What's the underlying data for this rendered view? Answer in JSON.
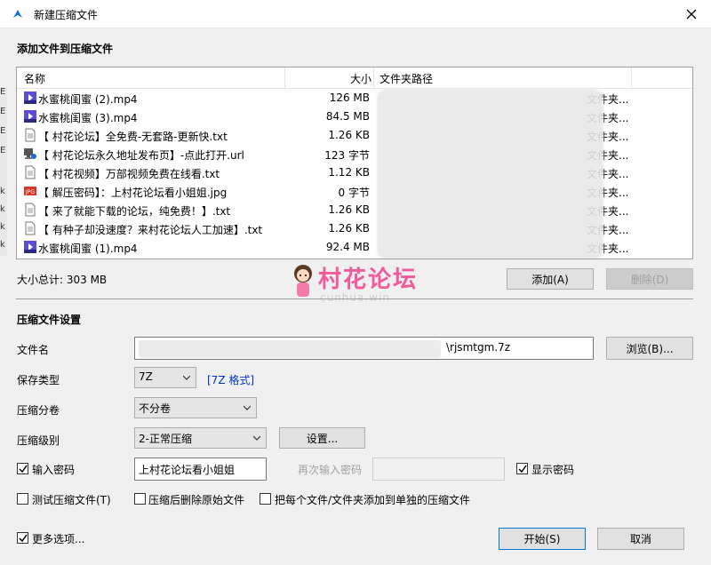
{
  "window": {
    "title": "新建压缩文件"
  },
  "background_strip": [
    "E",
    "E",
    "E",
    "E",
    "k",
    "k",
    "k",
    "k"
  ],
  "files_section": {
    "heading": "添加文件到压缩文件"
  },
  "table": {
    "columns": {
      "name": "名称",
      "size": "大小",
      "path": "文件夹路径"
    },
    "rows": [
      {
        "icon": "video-file-icon",
        "name": "水蜜桃闺蜜 (2).mp4",
        "size": "126 MB",
        "path": "文件夹..."
      },
      {
        "icon": "video-file-icon",
        "name": "水蜜桃闺蜜 (3).mp4",
        "size": "84.5 MB",
        "path": "文件夹..."
      },
      {
        "icon": "text-file-icon",
        "name": "【 村花论坛】全免费-无套路-更新快.txt",
        "size": "1.26 KB",
        "path": "文件夹..."
      },
      {
        "icon": "url-file-icon",
        "name": "【 村花论坛永久地址发布页】-点此打开.url",
        "size": "123 字节",
        "path": "文件夹..."
      },
      {
        "icon": "text-file-icon",
        "name": "【 村花视频】万部视频免费在线看.txt",
        "size": "1.12 KB",
        "path": "文件夹..."
      },
      {
        "icon": "jpg-file-icon",
        "name": "【 解压密码】：上村花论坛看小姐姐.jpg",
        "size": "0 字节",
        "path": "文件夹..."
      },
      {
        "icon": "text-file-icon",
        "name": "【 来了就能下载的论坛，纯免费！】.txt",
        "size": "1.26 KB",
        "path": "文件夹..."
      },
      {
        "icon": "text-file-icon",
        "name": "【 有种子却没速度？来村花论坛人工加速】.txt",
        "size": "1.26 KB",
        "path": "文件夹..."
      },
      {
        "icon": "video-file-icon",
        "name": "水蜜桃闺蜜 (1).mp4",
        "size": "92.4 MB",
        "path": "文件夹..."
      }
    ]
  },
  "total": {
    "label": "大小总计: 303 MB"
  },
  "watermark": {
    "title": "村花论坛",
    "subtitle": "cunhua.win"
  },
  "buttons": {
    "add": "添加(A)",
    "delete": "删除(D)",
    "browse": "浏览(B)...",
    "settings": "设置...",
    "start": "开始(S)",
    "cancel": "取消"
  },
  "settings_section": {
    "heading": "压缩文件设置"
  },
  "fields": {
    "filename_label": "文件名",
    "filename_value": "\\rjsmtgm.7z",
    "type_label": "保存类型",
    "type_value": "7Z",
    "type_link": "[7Z 格式]",
    "volume_label": "压缩分卷",
    "volume_value": "不分卷",
    "level_label": "压缩级别",
    "level_value": "2-正常压缩",
    "password_label": "输入密码",
    "password_value": "上村花论坛看小姐姐",
    "password_confirm_label": "再次输入密码",
    "show_password_label": "显示密码",
    "test_label": "测试压缩文件(T)",
    "delete_after_label": "压缩后删除原始文件",
    "separate_label": "把每个文件/文件夹添加到单独的压缩文件",
    "more_options_label": "更多选项..."
  },
  "colors": {
    "link": "#0033cc",
    "icon_blue": "#1e6fd0"
  }
}
